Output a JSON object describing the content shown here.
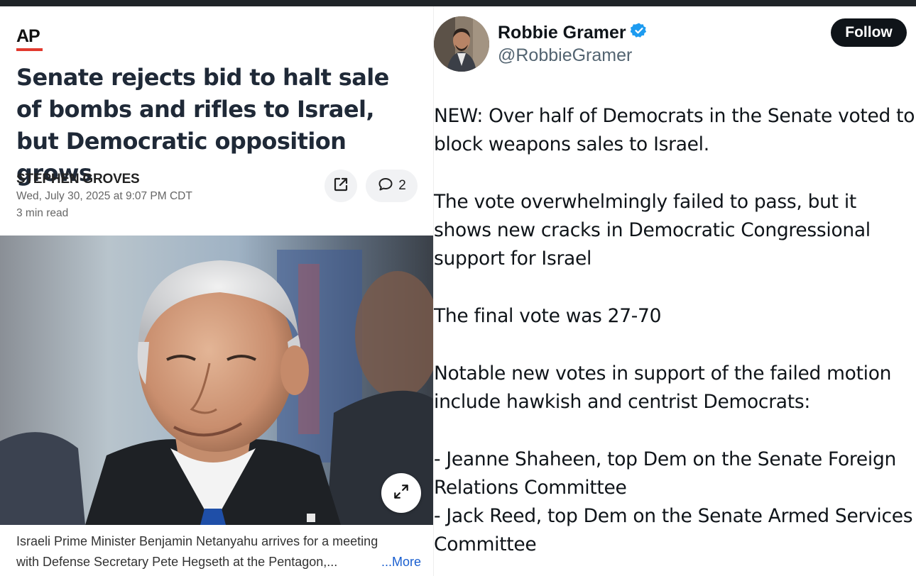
{
  "article": {
    "source_logo": "AP",
    "headline": "Senate rejects bid to halt sale of bombs and rifles to Israel, but Democratic opposition grows",
    "author": "STEPHEN GROVES",
    "date": "Wed, July 30, 2025 at 9:07 PM CDT",
    "read_time": "3 min read",
    "comment_count": "2",
    "caption_line1": "Israeli Prime Minister Benjamin Netanyahu arrives for a meeting",
    "caption_line2": "with Defense Secretary Pete Hegseth at the Pentagon,...",
    "more_label": "...More",
    "brand_red": "#e23a2e",
    "link_color": "#1a5fd0"
  },
  "tweet": {
    "author_name": "Robbie Gramer",
    "author_handle": "@RobbieGramer",
    "verified": true,
    "follow_label": "Follow",
    "paragraphs": [
      "NEW: Over half of Democrats in the Senate voted to block weapons sales to Israel.",
      "The vote overwhelmingly failed to pass, but it shows new cracks in Democratic Congressional support for Israel",
      "The final vote was 27-70",
      "Notable new votes in support of the failed motion include hawkish and centrist Democrats:"
    ],
    "list_lines": [
      "- Jeanne Shaheen, top Dem on the Senate Foreign Relations Committee",
      "- Jack Reed, top Dem on the Senate Armed Services Committee"
    ],
    "verified_color": "#1d9bf0"
  },
  "icons": {
    "share": "share-external-icon",
    "comment": "comment-bubble-icon",
    "expand": "expand-arrows-icon",
    "verified": "verified-badge-icon"
  }
}
